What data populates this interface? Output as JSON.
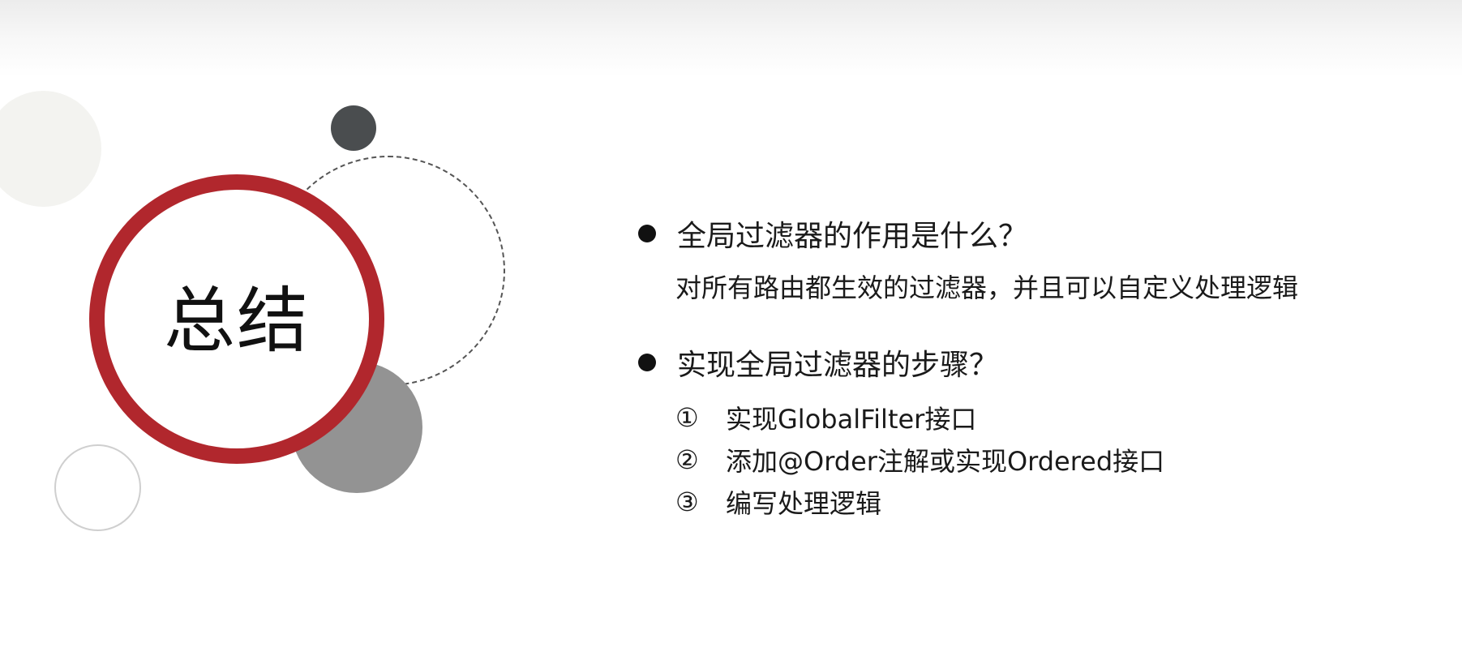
{
  "slide": {
    "title": "总结",
    "questions": [
      {
        "question": "全局过滤器的作用是什么？",
        "answer": "对所有路由都生效的过滤器，并且可以自定义处理逻辑"
      },
      {
        "question": "实现全局过滤器的步骤？",
        "steps": [
          {
            "num": "①",
            "text": "实现GlobalFilter接口"
          },
          {
            "num": "②",
            "text": "添加@Order注解或实现Ordered接口"
          },
          {
            "num": "③",
            "text": "编写处理逻辑"
          }
        ]
      }
    ]
  },
  "colors": {
    "accent_red": "#b1272d",
    "dark_circle": "#4a4d4f",
    "gray_circle": "#939393",
    "beige_circle": "#f3f3f0"
  }
}
